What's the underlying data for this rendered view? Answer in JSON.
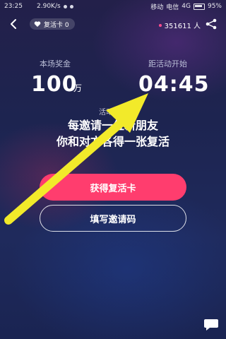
{
  "status_bar": {
    "time": "23:25",
    "speed": "2.90K/s",
    "carrier1": "移动",
    "carrier2": "电信",
    "network": "4G",
    "battery": "95%"
  },
  "top_bar": {
    "revive_card_label": "复活卡 0",
    "online_count": "351611 人"
  },
  "prize": {
    "label": "本场奖金",
    "amount": "100",
    "unit": "万"
  },
  "countdown": {
    "label": "距活动开始",
    "time": "04:45"
  },
  "rules": {
    "title": "活动规则",
    "line1": "每邀请一位新朋友",
    "line2": "你和对方各得一张复活"
  },
  "buttons": {
    "get_card": "获得复活卡",
    "enter_code": "填写邀请码"
  },
  "colors": {
    "accent": "#ff3d6e",
    "arrow": "#f2ea2a",
    "online_dot": "#ff4d8d"
  },
  "icons": [
    "back-icon",
    "heart-icon",
    "share-icon",
    "chat-icon",
    "wifi-icon",
    "battery-icon"
  ]
}
